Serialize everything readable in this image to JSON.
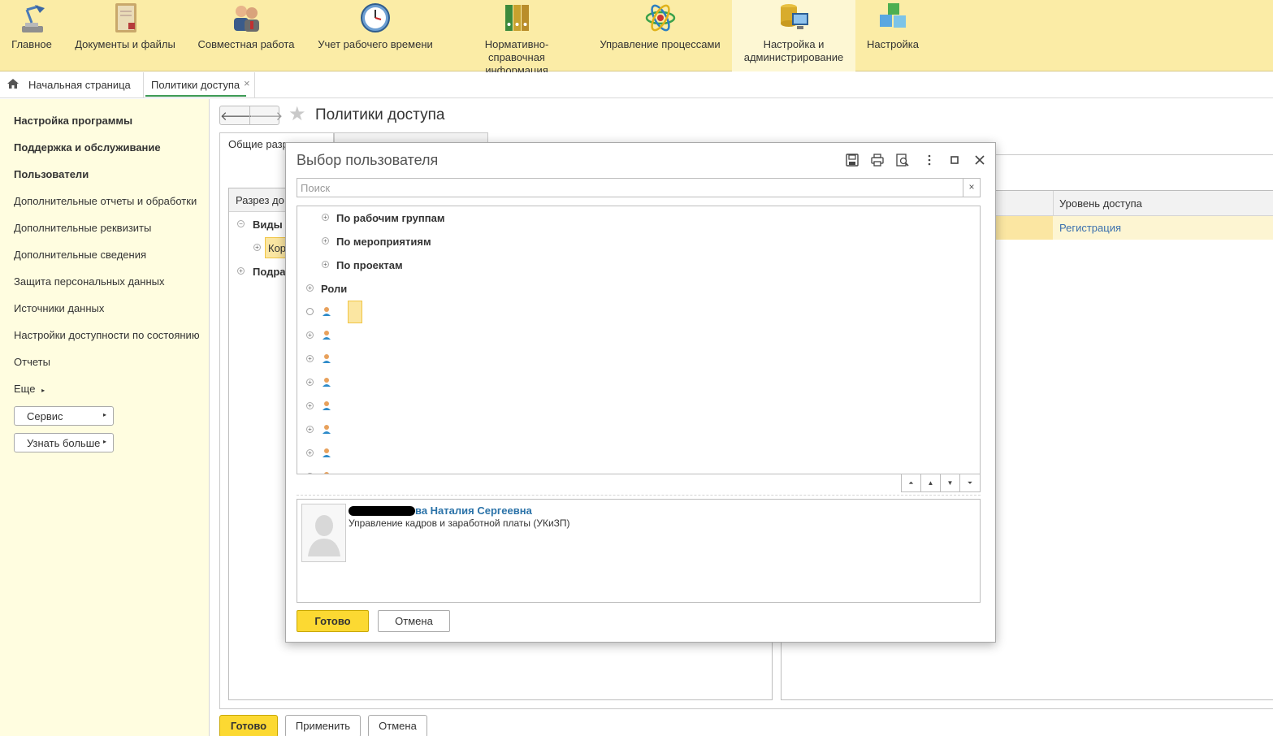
{
  "sections": [
    {
      "label": "Главное",
      "icon": "lamp-icon"
    },
    {
      "label": "Документы и файлы",
      "icon": "folder-documents-icon"
    },
    {
      "label": "Совместная работа",
      "icon": "people-icon"
    },
    {
      "label": "Учет рабочего времени",
      "icon": "clock-icon"
    },
    {
      "label": "Нормативно-справочная информация",
      "icon": "binders-icon"
    },
    {
      "label": "Управление процессами",
      "icon": "atom-icon"
    },
    {
      "label": "Настройка и администрирование",
      "icon": "computer-database-icon"
    },
    {
      "label": "Настройка",
      "icon": "cubes-icon"
    }
  ],
  "tabs": {
    "home": "Начальная страница",
    "current": "Политики доступа",
    "close": "×"
  },
  "leftnav": {
    "items": [
      "Настройка программы",
      "Поддержка и обслуживание",
      "Пользователи",
      "Дополнительные отчеты и обработки",
      "Дополнительные реквизиты",
      "Дополнительные сведения",
      "Защита персональных данных",
      "Источники данных",
      "Настройки доступности по состоянию",
      "Отчеты",
      "Еще"
    ],
    "more_arrow": "▸",
    "btn_service": "Сервис",
    "btn_learn": "Узнать больше",
    "btn_arrow": "▸"
  },
  "form": {
    "title": "Политики доступа",
    "back": "🡐",
    "forward": "🡒",
    "star": "★",
    "tab1": "Общие разр",
    "left_grid_header": "Разрез до",
    "left_rows": [
      {
        "text": "Виды",
        "bold": true
      },
      {
        "text": "Кор",
        "bold": false
      },
      {
        "text": "Подра",
        "bold": true
      }
    ],
    "right_grid_header": "Уровень доступа",
    "right_row_value": "Регистрация",
    "buttons": {
      "ok": "Готово",
      "apply": "Применить",
      "cancel": "Отмена"
    }
  },
  "modal": {
    "title": "Выбор пользователя",
    "search_placeholder": "Поиск",
    "search_clear": "×",
    "tree": [
      {
        "label": "По рабочим группам",
        "level": 2
      },
      {
        "label": "По мероприятиям",
        "level": 2
      },
      {
        "label": "По проектам",
        "level": 2
      },
      {
        "label": "Роли",
        "level": 1
      }
    ],
    "user": {
      "name": "ва Наталия Сергеевна",
      "org": "Управление кадров и заработной платы (УКиЗП)"
    },
    "buttons": {
      "ok": "Готово",
      "cancel": "Отмена"
    },
    "scroll": [
      "⏶",
      "▲",
      "▼",
      "⏷"
    ]
  }
}
